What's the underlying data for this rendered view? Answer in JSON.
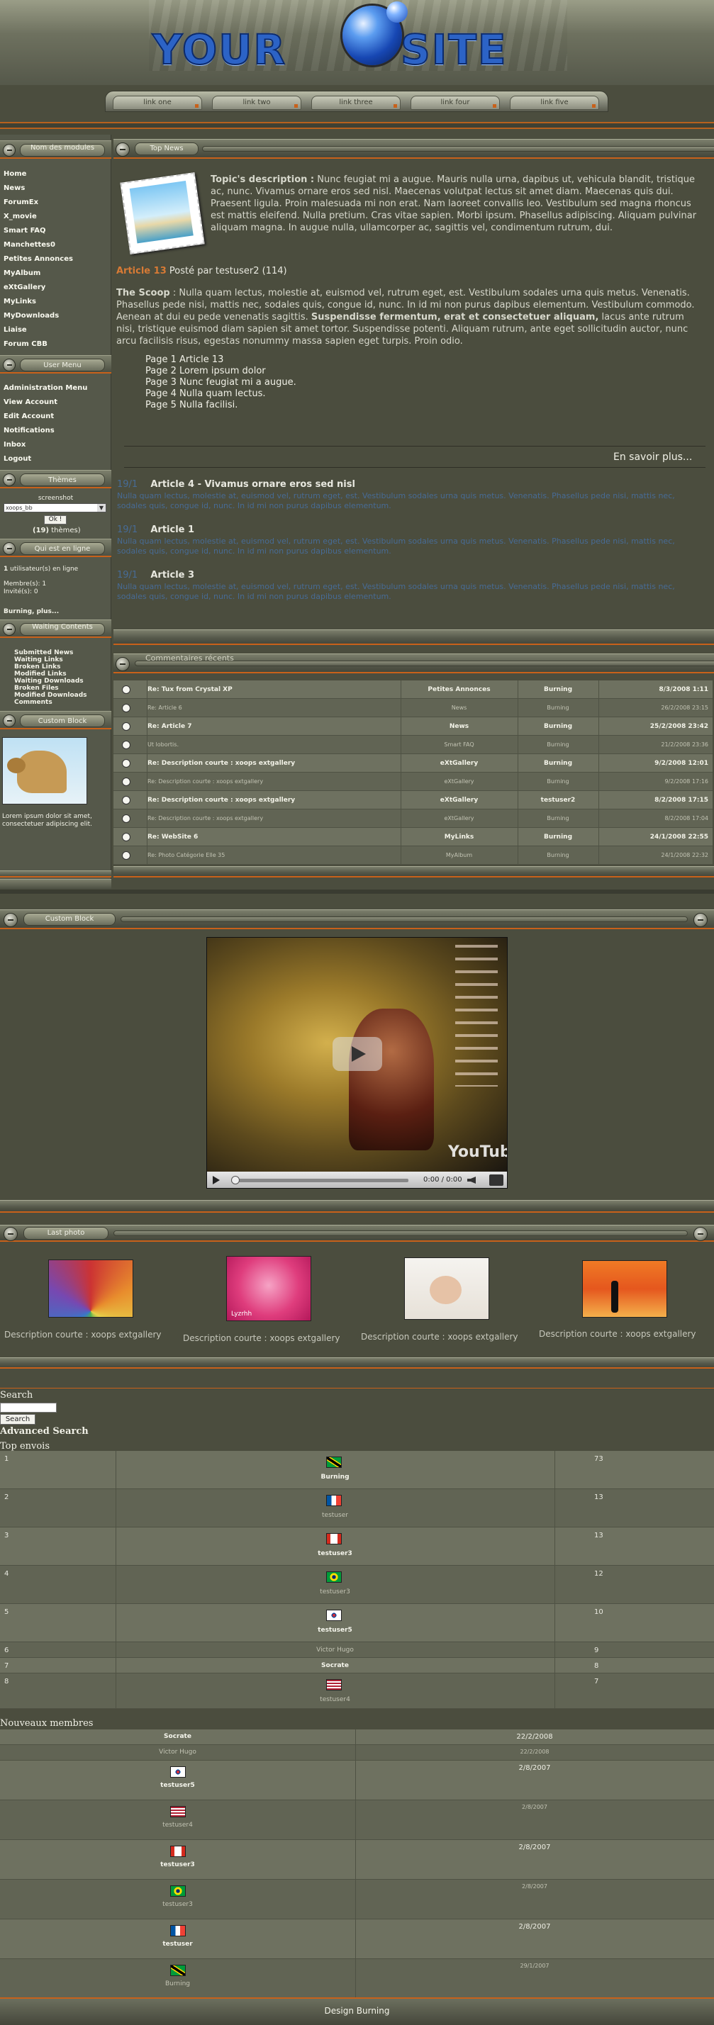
{
  "header": {
    "logo_word1": "YOUR",
    "logo_word2": "SITE",
    "nav": [
      "link one",
      "link two",
      "link three",
      "link four",
      "link five"
    ]
  },
  "left": {
    "main_menu_title": "Nom des modules",
    "main_menu": [
      "Home",
      "News",
      "ForumEx",
      "X_movie",
      "Smart FAQ",
      "Manchettes0",
      "Petites Annonces",
      "MyAlbum",
      "eXtGallery",
      "MyLinks",
      "MyDownloads",
      "Liaise",
      "Forum CBB"
    ],
    "user_menu_title": "User Menu",
    "user_menu": [
      "Administration Menu",
      "View Account",
      "Edit Account",
      "Notifications",
      "Inbox",
      "Logout"
    ],
    "themes_title": "Thèmes",
    "themes_label": "screenshot",
    "themes_select": "xoops_bb",
    "themes_ok": "Ok !",
    "themes_count_num": "(19)",
    "themes_count_text": " thèmes)",
    "online_title": "Qui est en ligne",
    "online_line1": "utilisateur(s) en ligne",
    "online_count": "1",
    "online_members": "Membre(s): 1",
    "online_guests": "Invité(s): 0",
    "online_users": "Burning, plus...",
    "waiting_title": "Waiting Contents",
    "waiting": [
      "Submitted News",
      "Waiting Links",
      "Broken Links",
      "Modified Links",
      "Waiting Downloads",
      "Broken Files",
      "Modified Downloads",
      "Comments"
    ],
    "custom_title": "Custom Block",
    "custom_text": "Lorem ipsum dolor sit amet, consectetuer adipiscing elit."
  },
  "topnews": {
    "title": "Top News",
    "desc_label": "Topic's description :",
    "desc_text": " Nunc feugiat mi a augue. Mauris nulla urna, dapibus ut, vehicula blandit, tristique ac, nunc. Vivamus ornare eros sed nisl. Maecenas volutpat lectus sit amet diam. Maecenas quis dui. Praesent ligula. Proin malesuada mi non erat. Nam laoreet convallis leo. Vestibulum sed magna rhoncus est mattis eleifend. Nulla pretium. Cras vitae sapien. Morbi ipsum. Phasellus adipiscing. Aliquam pulvinar aliquam magna. In augue nulla, ullamcorper ac, sagittis vel, condimentum rutrum, dui.",
    "article_title": "Article 13",
    "article_meta": " Posté par testuser2 (114)",
    "scoop_label": "The Scoop",
    "scoop_text1": " : Nulla quam lectus, molestie at, euismod vel, rutrum eget, est. Vestibulum sodales urna quis metus. Venenatis. Phasellus pede nisi, mattis nec, sodales quis, congue id, nunc. In id mi non purus dapibus elementum. Vestibulum commodo. Aenean at dui eu pede venenatis sagittis. ",
    "scoop_bold": "Suspendisse fermentum, erat et consectetuer aliquam,",
    "scoop_text2": " lacus ante rutrum nisi, tristique euismod diam sapien sit amet tortor. Suspendisse potenti. Aliquam rutrum, ante eget sollicitudin auctor, nunc arcu facilisis risus, egestas nonummy massa sapien eget turpis. Proin odio.",
    "pages": [
      "Page 1 Article 13",
      "Page 2 Lorem ipsum dolor",
      "Page 3 Nunc feugiat mi a augue.",
      "Page 4 Nulla quam lectus.",
      "Page 5 Nulla facilisi."
    ],
    "more": "En savoir plus...",
    "others": [
      {
        "date": "19/1",
        "title": "Article 4 - Vivamus ornare eros sed nisl"
      },
      {
        "date": "19/1",
        "title": "Article 1"
      },
      {
        "date": "19/1",
        "title": "Article 3"
      }
    ],
    "other_text": "Nulla quam lectus, molestie at, euismod vel, rutrum eget, est. Vestibulum sodales urna quis metus. Venenatis. Phasellus pede nisi, mattis nec, sodales quis, congue id, nunc. In id mi non purus dapibus elementum."
  },
  "comments": {
    "title": "Commentaires récents",
    "rows": [
      {
        "title": "Re: Tux from Crystal XP",
        "module": "Petites Annonces",
        "user": "Burning",
        "date": "8/3/2008 1:11"
      },
      {
        "title": "Re: Article 6",
        "module": "News",
        "user": "Burning",
        "date": "26/2/2008 23:15"
      },
      {
        "title": "Re: Article 7",
        "module": "News",
        "user": "Burning",
        "date": "25/2/2008 23:42"
      },
      {
        "title": "Ut lobortis.",
        "module": "Smart FAQ",
        "user": "Burning",
        "date": "21/2/2008 23:36"
      },
      {
        "title": "Re: Description courte : xoops extgallery",
        "module": "eXtGallery",
        "user": "Burning",
        "date": "9/2/2008 12:01"
      },
      {
        "title": "Re: Description courte : xoops extgallery",
        "module": "eXtGallery",
        "user": "Burning",
        "date": "9/2/2008 17:16"
      },
      {
        "title": "Re: Description courte : xoops extgallery",
        "module": "eXtGallery",
        "user": "testuser2",
        "date": "8/2/2008 17:15"
      },
      {
        "title": "Re: Description courte : xoops extgallery",
        "module": "eXtGallery",
        "user": "Burning",
        "date": "8/2/2008 17:04"
      },
      {
        "title": "Re: WebSite 6",
        "module": "MyLinks",
        "user": "Burning",
        "date": "24/1/2008 22:55"
      },
      {
        "title": "Re: Photo Catégorie Elle 35",
        "module": "MyAlbum",
        "user": "Burning",
        "date": "24/1/2008 22:32"
      }
    ]
  },
  "video": {
    "title": "Custom Block",
    "time": "0:00 / 0:00",
    "brand": "YouTube"
  },
  "lastphoto": {
    "title": "Last photo",
    "caption": "Description courte : xoops extgallery",
    "photo2_text": "Lyzrhh"
  },
  "search": {
    "label": "Search",
    "button": "Search",
    "advanced": "Advanced Search"
  },
  "topenvois": {
    "title": "Top envois",
    "rows": [
      {
        "rank": "1",
        "name": "Burning",
        "count": "73",
        "flag": "jm"
      },
      {
        "rank": "2",
        "name": "testuser",
        "count": "13",
        "flag": "fr"
      },
      {
        "rank": "3",
        "name": "testuser3",
        "count": "13",
        "flag": "ca"
      },
      {
        "rank": "4",
        "name": "testuser3",
        "count": "12",
        "flag": "br"
      },
      {
        "rank": "5",
        "name": "testuser5",
        "count": "10",
        "flag": "kr"
      },
      {
        "rank": "6",
        "name": "Victor Hugo",
        "count": "9",
        "flag": ""
      },
      {
        "rank": "7",
        "name": "Socrate",
        "count": "8",
        "flag": ""
      },
      {
        "rank": "8",
        "name": "testuser4",
        "count": "7",
        "flag": "us"
      }
    ]
  },
  "nouveaux": {
    "title": "Nouveaux membres",
    "rows": [
      {
        "name": "Socrate",
        "date": "22/2/2008",
        "flag": ""
      },
      {
        "name": "Victor Hugo",
        "date": "22/2/2008",
        "flag": ""
      },
      {
        "name": "testuser5",
        "date": "2/8/2007",
        "flag": "kr"
      },
      {
        "name": "testuser4",
        "date": "2/8/2007",
        "flag": "us"
      },
      {
        "name": "testuser3",
        "date": "2/8/2007",
        "flag": "ca"
      },
      {
        "name": "testuser3",
        "date": "2/8/2007",
        "flag": "br"
      },
      {
        "name": "testuser",
        "date": "2/8/2007",
        "flag": "fr"
      },
      {
        "name": "Burning",
        "date": "29/1/2007",
        "flag": "jm"
      }
    ]
  },
  "footer": {
    "text": "Design Burning"
  }
}
